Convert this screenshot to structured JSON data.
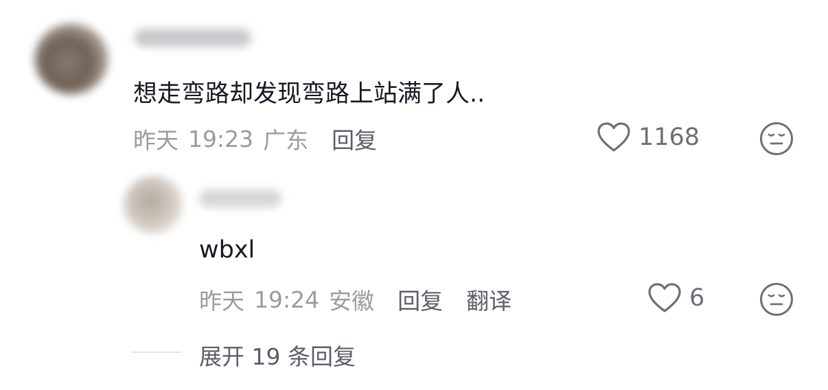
{
  "comment": {
    "text": "想走弯路却发现弯路上站满了人..",
    "date": "昨天",
    "time": "19:23",
    "location": "广东",
    "reply_label": "回复",
    "like_count": "1168"
  },
  "reply": {
    "text": "wbxl",
    "date": "昨天",
    "time": "19:24",
    "location": "安徽",
    "reply_label": "回复",
    "translate_label": "翻译",
    "like_count": "6"
  },
  "expand": {
    "label": "展开 19 条回复"
  },
  "colors": {
    "text_primary": "#161823",
    "text_meta": "#9a9ba0",
    "text_action": "#5c5e66",
    "icon": "#6d6f77"
  },
  "icons": {
    "like": "heart-outline-icon",
    "dislike": "meh-face-icon"
  }
}
